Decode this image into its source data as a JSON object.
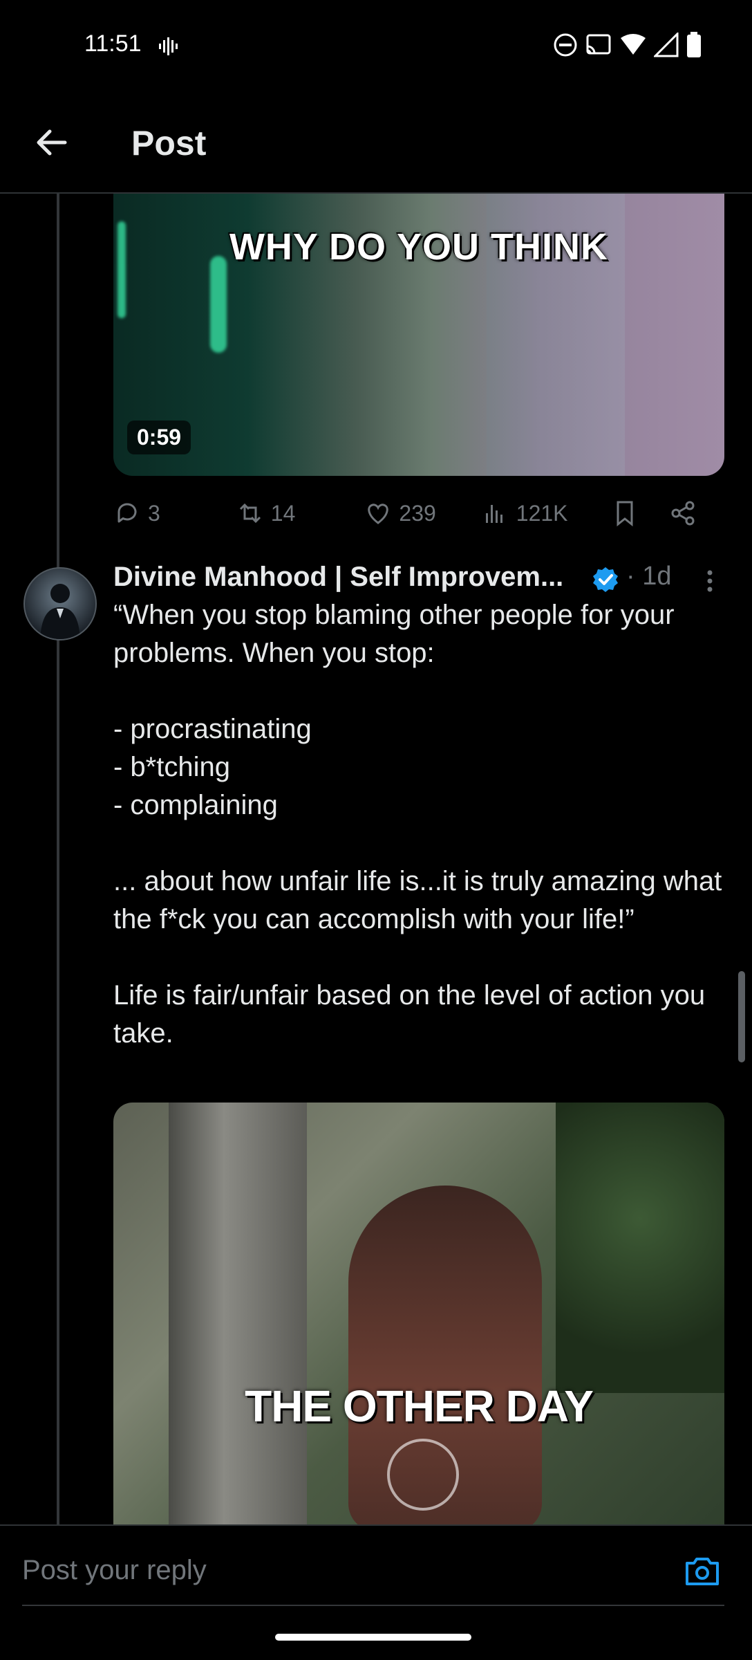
{
  "status_bar": {
    "time": "11:51"
  },
  "header": {
    "title": "Post"
  },
  "media1": {
    "caption": "WHY DO YOU THINK",
    "duration": "0:59"
  },
  "actions": {
    "replies": "3",
    "reposts": "14",
    "likes": "239",
    "views": "121K"
  },
  "post": {
    "author": "Divine Manhood | Self Improvem...",
    "time": "· 1d",
    "text": "“When you stop blaming other people for your problems. When you stop:\n\n- procrastinating\n- b*tching\n- complaining\n\n... about how unfair life is...it is truly amazing what the f*ck you can accomplish with your life!”\n\nLife is fair/unfair based on the level of action you take."
  },
  "media2": {
    "caption": "THE OTHER DAY"
  },
  "reply": {
    "placeholder": "Post your reply"
  },
  "colors": {
    "accent": "#1d9bf0",
    "muted": "#71767b",
    "text": "#e7e9ea"
  }
}
